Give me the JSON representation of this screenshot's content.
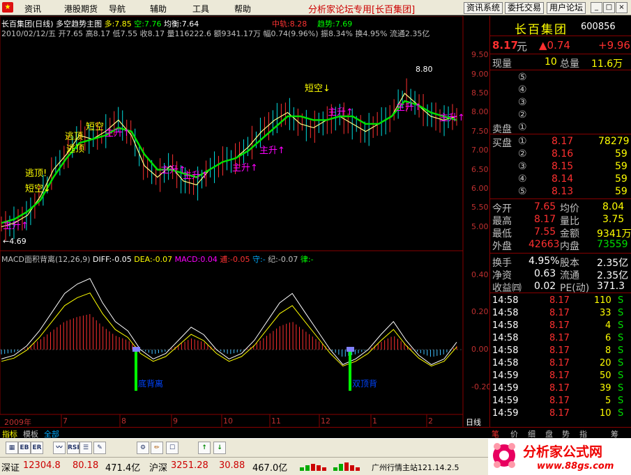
{
  "menubar": {
    "items": [
      "资讯",
      "港股期货",
      "导航",
      "辅助",
      "工具",
      "帮助"
    ],
    "center_title": "分析家论坛专用",
    "stock_tag": "[长百集团]",
    "right_buttons": [
      "资讯系统",
      "委托交易",
      "用户论坛"
    ],
    "window_buttons": [
      "_",
      "□",
      "×"
    ]
  },
  "chart": {
    "header1_title": "长百集团(日线)",
    "header1_template": "多空趋势主图",
    "header1_vals": [
      "多:7.85",
      "空:7.76",
      "均衡:7.64",
      "中轨:8.28",
      "趋势:7.69"
    ],
    "header2": "2010/02/12/五 开7.65 高8.17 低7.55 收8.17 量116222.6 额9341.17万 幅0.74(9.96%) 振8.34% 换4.95% 流通2.35亿",
    "price_ticks": [
      "9.50",
      "9.00",
      "8.50",
      "8.00",
      "7.50",
      "7.00",
      "6.50",
      "6.00",
      "5.50",
      "5.00"
    ],
    "high_mark": "8.80",
    "low_mark": "4.69",
    "annotations": [
      "逃顶!",
      "短空↓",
      "逃顶",
      "逃顶",
      "短空",
      "主升↑",
      "主升↑",
      "主升↑",
      "主升↑",
      "主升↑",
      "短空↓",
      "主升↑",
      "主升↑",
      "主升↑",
      "主升↑"
    ],
    "indicator_header": [
      "MACD面积背离(12,26,9)",
      "DIFF:-0.05",
      "DEA:-0.07",
      "MACD:0.04",
      "逋:-0.05",
      "守:-",
      "纪:-0.07",
      "律:-"
    ],
    "macd_ticks": [
      "0.40",
      "0.20",
      "0.00",
      "-0.20"
    ],
    "macd_labels": [
      "底背离",
      "双顶背"
    ],
    "x_labels": [
      "2009年",
      "7",
      "8",
      "9",
      "10",
      "11",
      "12",
      "1",
      "2"
    ],
    "period": "日线"
  },
  "chart_data": {
    "type": "line",
    "title": "长百集团(日线)",
    "ylim": [
      4.5,
      9.8
    ],
    "series": [
      {
        "name": "多",
        "values": [
          5.0,
          5.1,
          5.3,
          5.8,
          6.5,
          6.9,
          7.4,
          7.3,
          7.5,
          7.8,
          7.4,
          6.6,
          6.3,
          6.6,
          6.2,
          6.1,
          6.5,
          6.7,
          6.8,
          7.1,
          7.5,
          7.8,
          8.0,
          7.7,
          7.6,
          7.8,
          7.9,
          7.7,
          7.5,
          7.7,
          7.9,
          8.5,
          8.2,
          7.9,
          7.8,
          7.9
        ]
      },
      {
        "name": "空",
        "values": [
          5.1,
          5.2,
          5.4,
          5.7,
          6.3,
          6.8,
          7.2,
          7.3,
          7.4,
          7.6,
          7.5,
          6.9,
          6.5,
          6.5,
          6.4,
          6.3,
          6.5,
          6.7,
          6.8,
          7.0,
          7.3,
          7.6,
          7.9,
          7.9,
          7.8,
          7.8,
          7.9,
          7.9,
          7.7,
          7.7,
          7.9,
          8.3,
          8.2,
          8.0,
          7.9,
          7.8
        ]
      }
    ],
    "macd_values": [
      -0.05,
      -0.03,
      0.02,
      0.1,
      0.2,
      0.3,
      0.35,
      0.38,
      0.25,
      0.15,
      0.1,
      0.0,
      -0.05,
      -0.02,
      0.05,
      0.12,
      0.08,
      0.0,
      -0.05,
      -0.02,
      0.05,
      0.15,
      0.25,
      0.3,
      0.2,
      0.1,
      0.0,
      -0.08,
      -0.05,
      0.0,
      0.08,
      0.15,
      0.05,
      -0.03,
      -0.08,
      -0.05,
      0.04
    ]
  },
  "right_panel": {
    "name": "长百集团",
    "code": "600856",
    "price": "8.17",
    "price_unit": "元",
    "change": "▲0.74",
    "change_pct": "+9.96",
    "current_vol_label": "现量",
    "current_vol": "10",
    "total_vol_label": "总量",
    "total_vol": "11.6万",
    "sell_label": "卖盘",
    "sell_levels": [
      "⑤",
      "④",
      "③",
      "②",
      "①"
    ],
    "buy_label": "买盘",
    "buy_levels": [
      {
        "lvl": "①",
        "price": "8.17",
        "vol": "78279"
      },
      {
        "lvl": "②",
        "price": "8.16",
        "vol": "59"
      },
      {
        "lvl": "③",
        "price": "8.15",
        "vol": "59"
      },
      {
        "lvl": "④",
        "price": "8.14",
        "vol": "59"
      },
      {
        "lvl": "⑤",
        "price": "8.13",
        "vol": "59"
      }
    ],
    "stats": [
      {
        "l1": "今开",
        "v1": "7.65",
        "l2": "均价",
        "v2": "8.04"
      },
      {
        "l1": "最高",
        "v1": "8.17",
        "l2": "量比",
        "v2": "3.75"
      },
      {
        "l1": "最低",
        "v1": "7.55",
        "l2": "金额",
        "v2": "9341万"
      },
      {
        "l1": "外盘",
        "v1": "42663",
        "l2": "内盘",
        "v2": "73559"
      }
    ],
    "stats2": [
      {
        "l1": "换手",
        "v1": "4.95%",
        "l2": "股本",
        "v2": "2.35亿"
      },
      {
        "l1": "净资",
        "v1": "0.63",
        "l2": "流通",
        "v2": "2.35亿"
      },
      {
        "l1": "收益㈣",
        "v1": "0.02",
        "l2": "PE(动)",
        "v2": "371.3"
      }
    ],
    "ticks": [
      {
        "t": "14:58",
        "p": "8.17",
        "v": "110",
        "s": "S"
      },
      {
        "t": "14:58",
        "p": "8.17",
        "v": "33",
        "s": "S"
      },
      {
        "t": "14:58",
        "p": "8.17",
        "v": "4",
        "s": "S"
      },
      {
        "t": "14:58",
        "p": "8.17",
        "v": "6",
        "s": "S"
      },
      {
        "t": "14:58",
        "p": "8.17",
        "v": "8",
        "s": "S"
      },
      {
        "t": "14:58",
        "p": "8.17",
        "v": "20",
        "s": "S"
      },
      {
        "t": "14:59",
        "p": "8.17",
        "v": "50",
        "s": "S"
      },
      {
        "t": "14:59",
        "p": "8.17",
        "v": "39",
        "s": "S"
      },
      {
        "t": "14:59",
        "p": "8.17",
        "v": "5",
        "s": "S"
      },
      {
        "t": "14:59",
        "p": "8.17",
        "v": "10",
        "s": "S"
      }
    ],
    "bottom_tabs": [
      "笔",
      "价",
      "细",
      "盘",
      "势",
      "指",
      "筹"
    ]
  },
  "tabs": [
    "指标",
    "模板",
    "全部"
  ],
  "toolbar_icons": [
    "tb-icon-1",
    "tb-icon-2",
    "tb-icon-3",
    "tb-icon-4",
    "tb-icon-5",
    "tb-icon-6",
    "tb-icon-7",
    "tb-icon-8",
    "tb-icon-9",
    "tb-icon-10",
    "tb-icon-11",
    "tb-icon-12"
  ],
  "statusbar": {
    "sz_label": "深证",
    "sz_index": "12304.8",
    "sz_change": "80.18",
    "sz_amount": "471.4亿",
    "sh_label": "沪深",
    "sh_index": "3251.28",
    "sh_change": "30.88",
    "sh_amount": "467.0亿",
    "server": "广州行情主站121.14.2.5"
  },
  "banner": {
    "title": "分析家公式网",
    "url": "www.88gs.com"
  },
  "colors": {
    "up": "#ff3030",
    "down": "#00e000",
    "accent_yellow": "#ffff00",
    "label_gray": "#c0c0c0"
  }
}
